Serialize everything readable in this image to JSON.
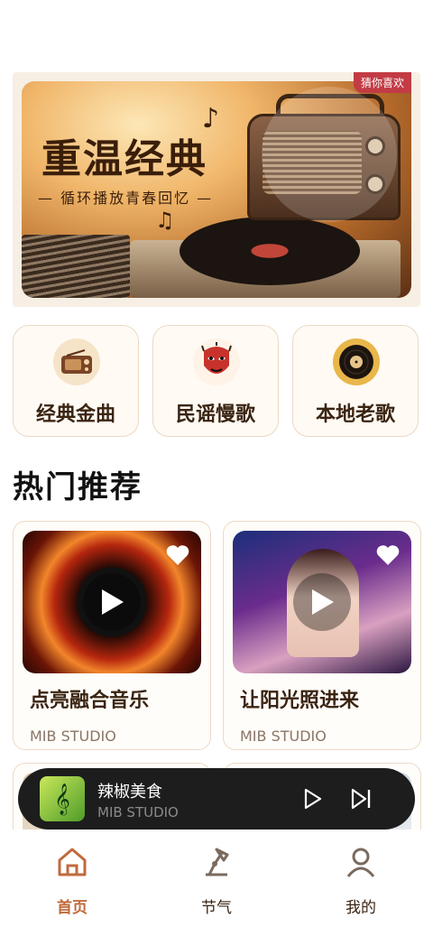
{
  "banner": {
    "title": "重温经典",
    "subtitle": "— 循环播放青春回忆 —",
    "badge": "猜你喜欢"
  },
  "categories": [
    {
      "label": "经典金曲",
      "icon": "radio-icon"
    },
    {
      "label": "民谣慢歌",
      "icon": "opera-mask-icon"
    },
    {
      "label": "本地老歌",
      "icon": "vinyl-record-icon"
    }
  ],
  "section": {
    "title": "热门推荐"
  },
  "cards": [
    {
      "title": "点亮融合音乐",
      "subtitle": "MIB STUDIO"
    },
    {
      "title": "让阳光照进来",
      "subtitle": "MIB STUDIO"
    }
  ],
  "player": {
    "title": "辣椒美食",
    "subtitle": "MIB STUDIO"
  },
  "tabs": [
    {
      "label": "首页",
      "icon": "home-icon",
      "active": true
    },
    {
      "label": "节气",
      "icon": "lamp-icon",
      "active": false
    },
    {
      "label": "我的",
      "icon": "user-icon",
      "active": false
    }
  ],
  "colors": {
    "accent": "#c06a3c",
    "badge": "#c23b45",
    "player_bg": "#1d1d1d"
  }
}
